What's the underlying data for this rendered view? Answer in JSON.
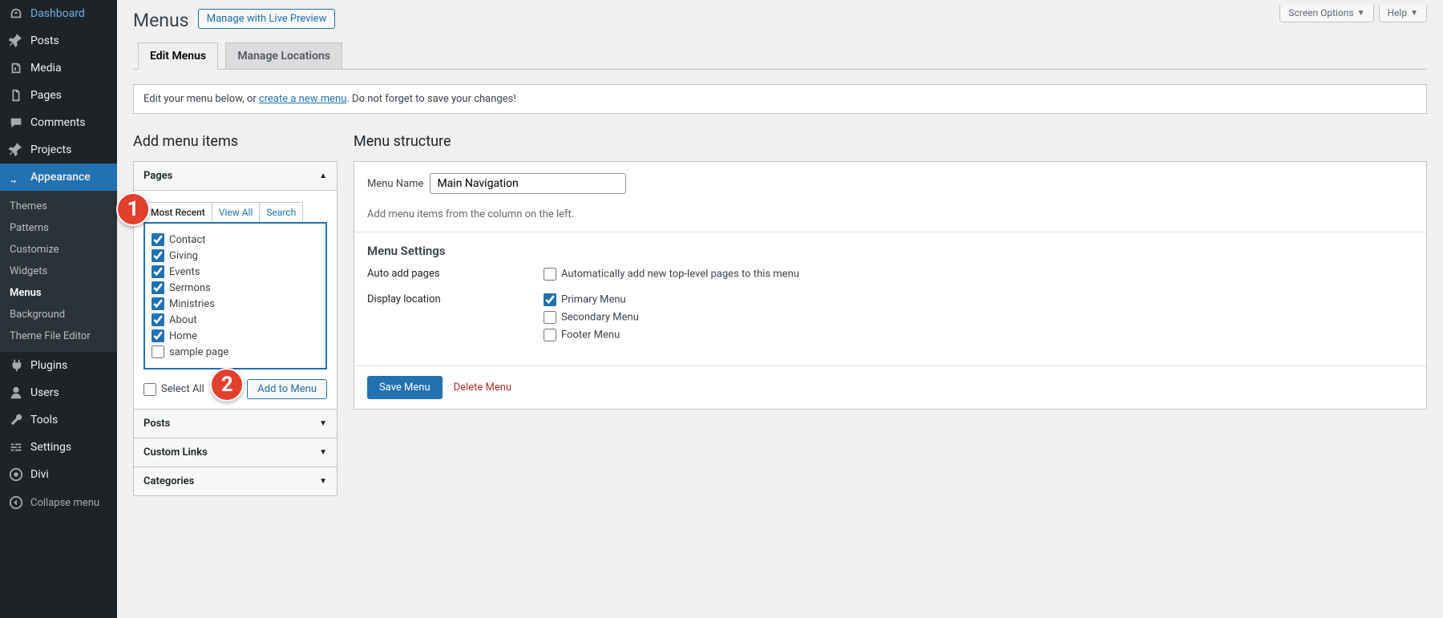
{
  "sidebar": {
    "items": [
      {
        "label": "Dashboard"
      },
      {
        "label": "Posts"
      },
      {
        "label": "Media"
      },
      {
        "label": "Pages"
      },
      {
        "label": "Comments"
      },
      {
        "label": "Projects"
      },
      {
        "label": "Appearance"
      },
      {
        "label": "Plugins"
      },
      {
        "label": "Users"
      },
      {
        "label": "Tools"
      },
      {
        "label": "Settings"
      },
      {
        "label": "Divi"
      }
    ],
    "sub": [
      "Themes",
      "Patterns",
      "Customize",
      "Widgets",
      "Menus",
      "Background",
      "Theme File Editor"
    ],
    "collapse": "Collapse menu"
  },
  "top": {
    "screen": "Screen Options",
    "help": "Help"
  },
  "title": "Menus",
  "title_action": "Manage with Live Preview",
  "tabs": {
    "edit": "Edit Menus",
    "locations": "Manage Locations"
  },
  "notice": {
    "pre": "Edit your menu below, or ",
    "link": "create a new menu",
    "post": ". Do not forget to save your changes!"
  },
  "left": {
    "heading": "Add menu items",
    "pages_title": "Pages",
    "filters": [
      "Most Recent",
      "View All",
      "Search"
    ],
    "pages": [
      {
        "label": "Contact",
        "checked": true
      },
      {
        "label": "Giving",
        "checked": true
      },
      {
        "label": "Events",
        "checked": true
      },
      {
        "label": "Sermons",
        "checked": true
      },
      {
        "label": "Ministries",
        "checked": true
      },
      {
        "label": "About",
        "checked": true
      },
      {
        "label": "Home",
        "checked": true
      },
      {
        "label": "sample page",
        "checked": false
      }
    ],
    "select_all": "Select All",
    "add_to_menu": "Add to Menu",
    "acc_posts": "Posts",
    "acc_custom": "Custom Links",
    "acc_cats": "Categories"
  },
  "right": {
    "heading": "Menu structure",
    "name_label": "Menu Name",
    "name_value": "Main Navigation",
    "hint": "Add menu items from the column on the left.",
    "settings_h": "Menu Settings",
    "auto_label": "Auto add pages",
    "auto_opt": "Automatically add new top-level pages to this menu",
    "loc_label": "Display location",
    "loc_opts": [
      {
        "label": "Primary Menu",
        "checked": true
      },
      {
        "label": "Secondary Menu",
        "checked": false
      },
      {
        "label": "Footer Menu",
        "checked": false
      }
    ],
    "save": "Save Menu",
    "delete": "Delete Menu"
  },
  "badges": {
    "one": "1",
    "two": "2"
  }
}
